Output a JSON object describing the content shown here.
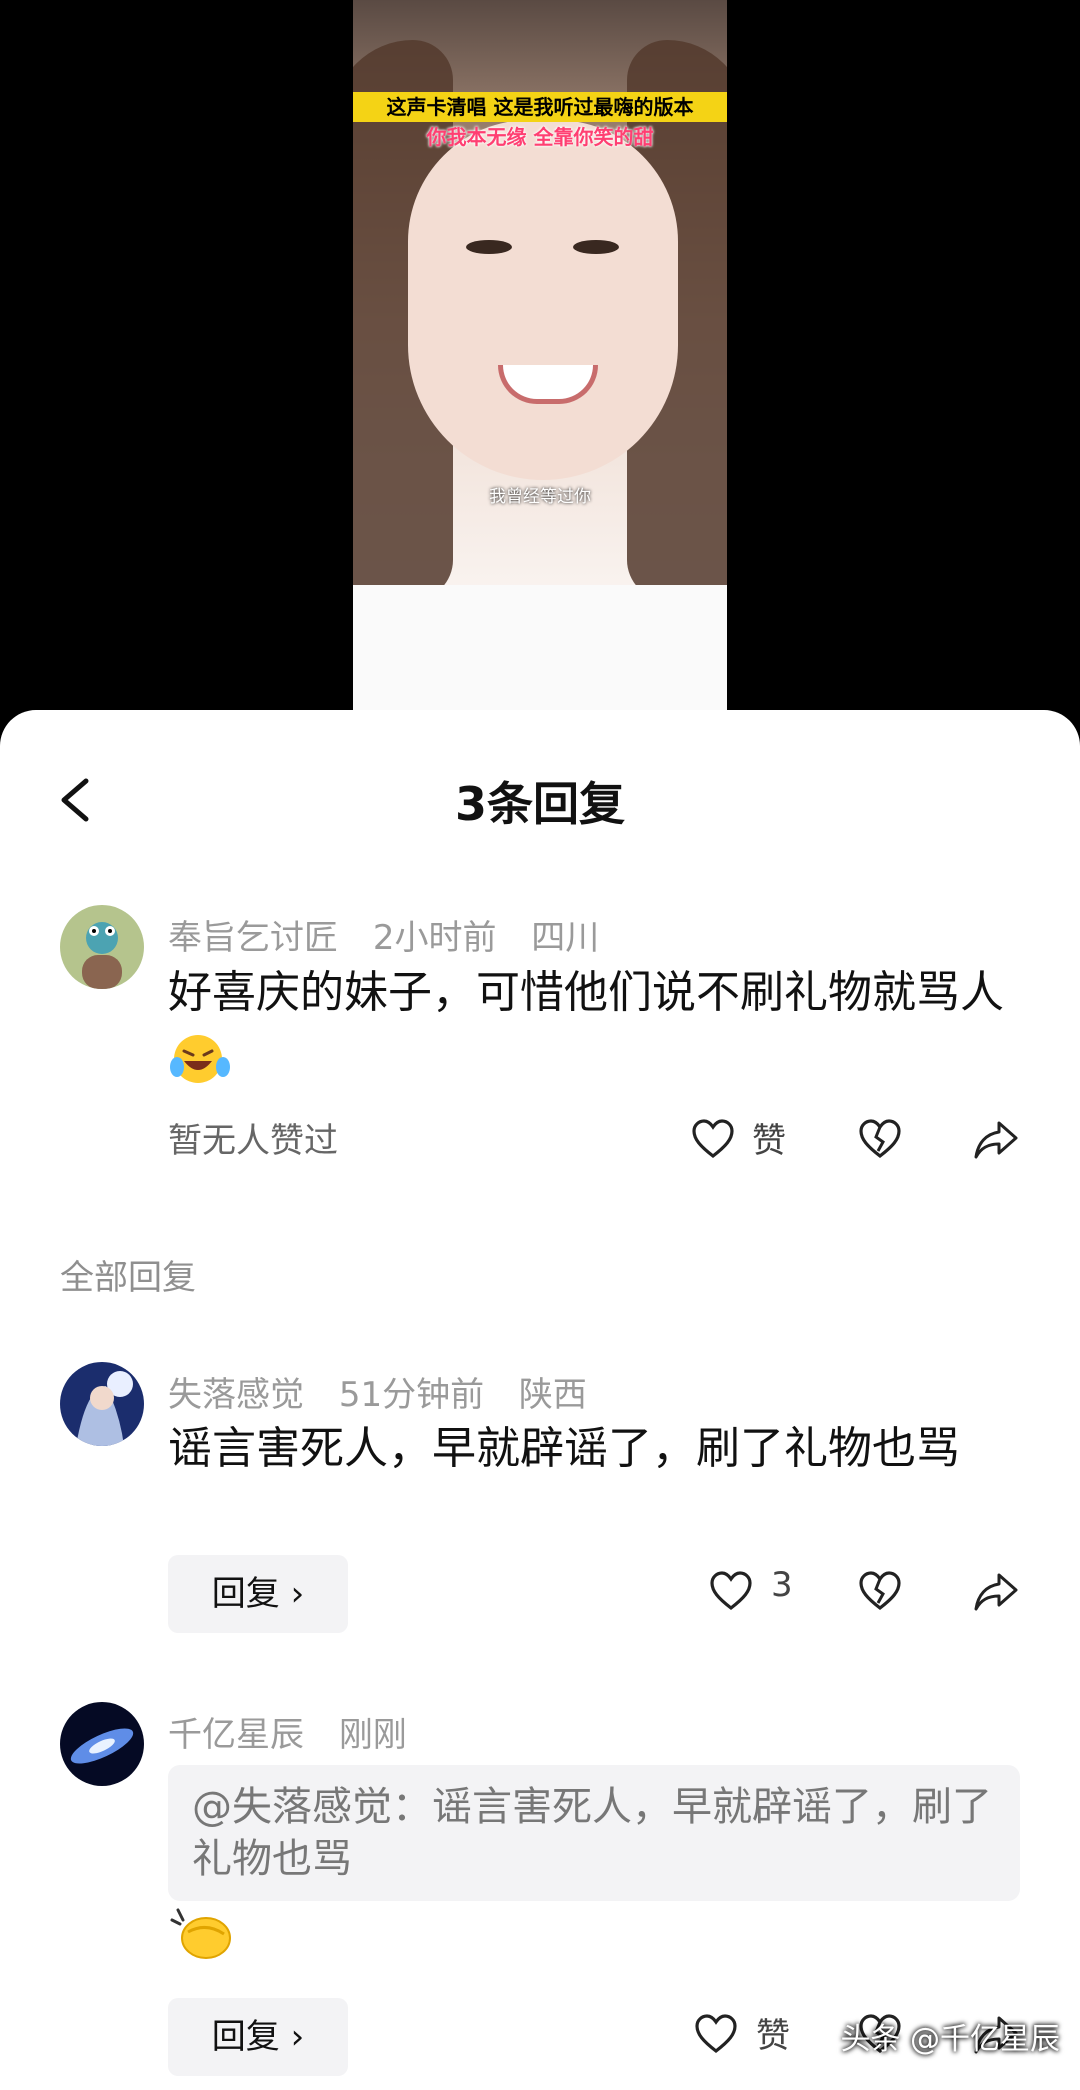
{
  "video": {
    "overlay_line1": "这声卡清唱 这是我听过最嗨的版本",
    "overlay_line2": "你我本无缘 全靠你笑的甜",
    "lyric": "我曾经等过你"
  },
  "header": {
    "title": "3条回复"
  },
  "main_comment": {
    "username": "奉旨乞讨匠",
    "time": "2小时前",
    "location": "四川",
    "text": "好喜庆的妹子，可惜他们说不刷礼物就骂人",
    "emoji_name": "laugh-cry-emoji",
    "like_status": "暂无人赞过",
    "like_label": "赞"
  },
  "section": {
    "label": "全部回复"
  },
  "replies": [
    {
      "username": "失落感觉",
      "time": "51分钟前",
      "location": "陕西",
      "text": "谣言害死人，早就辟谣了，刷了礼物也骂",
      "reply_label": "回复 ›",
      "like_count": "3"
    },
    {
      "username": "千亿星辰",
      "time": "刚刚",
      "quote": "@失落感觉：谣言害死人，早就辟谣了，刷了礼物也骂",
      "emoji_name": "clap-emoji",
      "reply_label": "回复 ›",
      "like_label": "赞"
    }
  ],
  "watermark": "头条 @千亿星辰",
  "colors": {
    "overlay_yellow": "#f4d315",
    "overlay_pink": "#ff3f72",
    "meta_gray": "#9a9a9a",
    "bubble_bg": "#f3f3f5"
  }
}
